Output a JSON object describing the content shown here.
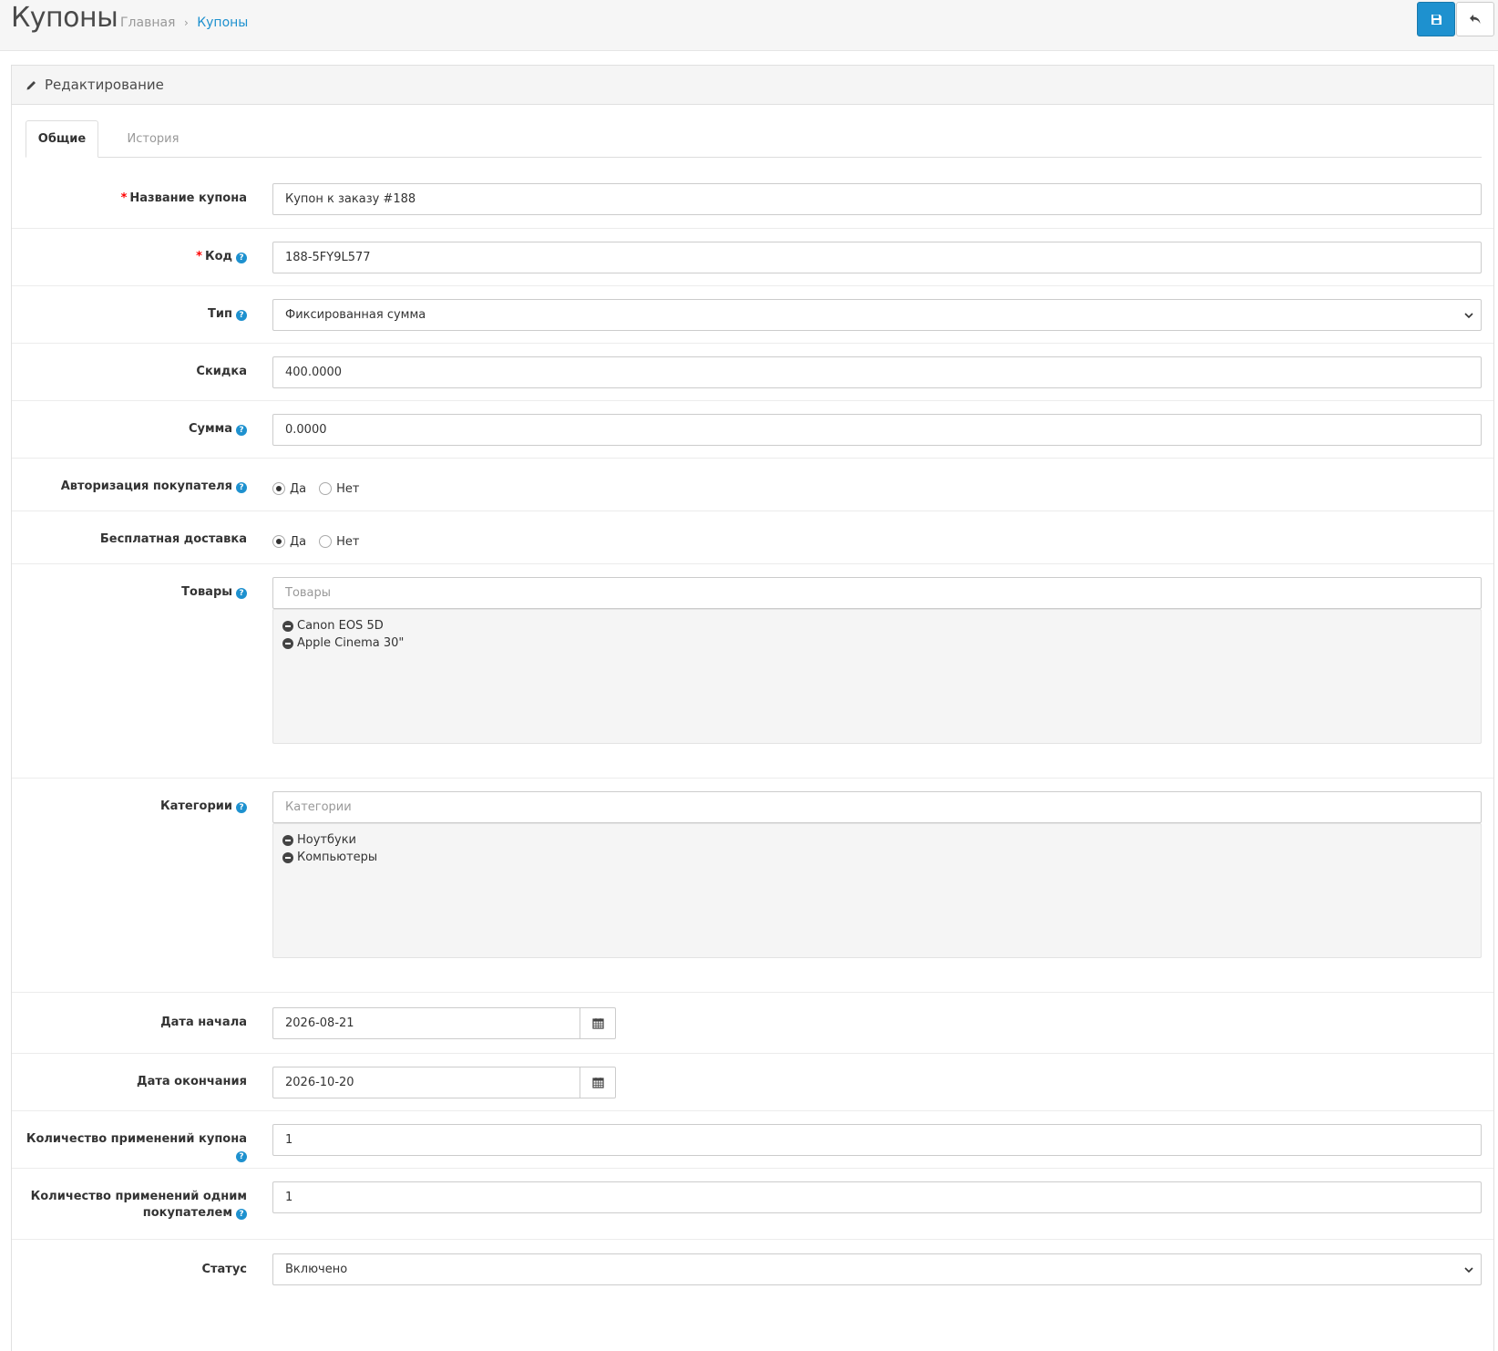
{
  "header": {
    "title": "Купоны",
    "breadcrumb": {
      "home": "Главная",
      "separator": "›",
      "current": "Купоны"
    }
  },
  "panel": {
    "heading": "Редактирование",
    "tabs": [
      "Общие",
      "История"
    ]
  },
  "form": {
    "name": {
      "label": "Название купона",
      "value": "Купон к заказу #188"
    },
    "code": {
      "label": "Код",
      "value": "188-5FY9L577"
    },
    "type": {
      "label": "Тип",
      "value": "Фиксированная сумма"
    },
    "discount": {
      "label": "Скидка",
      "value": "400.0000"
    },
    "total": {
      "label": "Сумма",
      "value": "0.0000"
    },
    "logged": {
      "label": "Авторизация покупателя",
      "yes": "Да",
      "no": "Нет",
      "selected": "Да"
    },
    "shipping": {
      "label": "Бесплатная доставка",
      "yes": "Да",
      "no": "Нет",
      "selected": "Да"
    },
    "products": {
      "label": "Товары",
      "placeholder": "Товары",
      "items": [
        "Canon EOS 5D",
        "Apple Cinema 30\""
      ]
    },
    "categories": {
      "label": "Категории",
      "placeholder": "Категории",
      "items": [
        "Ноутбуки",
        "Компьютеры"
      ]
    },
    "date_start": {
      "label": "Дата начала",
      "value": "2026-08-21"
    },
    "date_end": {
      "label": "Дата окончания",
      "value": "2026-10-20"
    },
    "uses_total": {
      "label": "Количество применений купона",
      "value": "1"
    },
    "uses_customer": {
      "label_line1": "Количество применений одним",
      "label_line2": "покупателем",
      "value": "1"
    },
    "status": {
      "label": "Статус",
      "value": "Включено"
    }
  },
  "icons": {
    "save": "save-icon",
    "back": "reply-icon",
    "pencil": "pencil-icon",
    "help": "question-circle-icon",
    "calendar": "calendar-icon",
    "remove": "minus-circle-icon"
  },
  "colors": {
    "accent": "#1e91cf",
    "required": "#ff0000"
  }
}
